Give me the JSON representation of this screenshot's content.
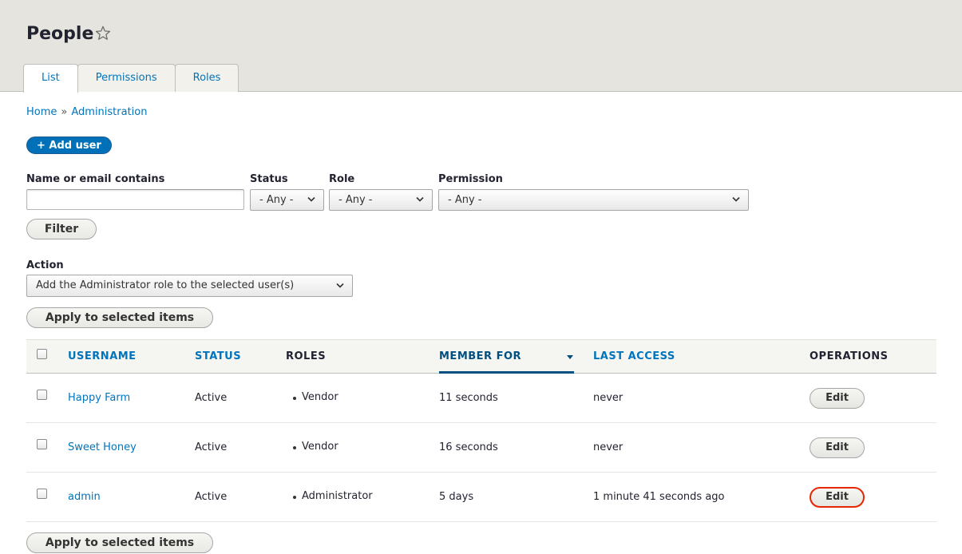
{
  "header": {
    "title": "People",
    "tabs": [
      {
        "label": "List",
        "active": true
      },
      {
        "label": "Permissions",
        "active": false
      },
      {
        "label": "Roles",
        "active": false
      }
    ]
  },
  "breadcrumb": {
    "items": [
      "Home",
      "Administration"
    ],
    "separator": "»"
  },
  "add_user_label": "+ Add user",
  "filters": {
    "name_label": "Name or email contains",
    "name_value": "",
    "status_label": "Status",
    "status_value": "- Any -",
    "role_label": "Role",
    "role_value": "- Any -",
    "permission_label": "Permission",
    "permission_value": "- Any -",
    "filter_button": "Filter"
  },
  "action": {
    "label": "Action",
    "value": "Add the Administrator role to the selected user(s)",
    "apply_button": "Apply to selected items"
  },
  "table": {
    "columns": {
      "username": "USERNAME",
      "status": "STATUS",
      "roles": "ROLES",
      "member_for": "MEMBER FOR",
      "last_access": "LAST ACCESS",
      "operations": "OPERATIONS"
    },
    "sorted_column": "member_for",
    "rows": [
      {
        "username": "Happy Farm",
        "status": "Active",
        "role": "Vendor",
        "member_for": "11 seconds",
        "last_access": "never",
        "operation": "Edit"
      },
      {
        "username": "Sweet Honey",
        "status": "Active",
        "role": "Vendor",
        "member_for": "16 seconds",
        "last_access": "never",
        "operation": "Edit"
      },
      {
        "username": "admin",
        "status": "Active",
        "role": "Administrator",
        "member_for": "5 days",
        "last_access": "1 minute 41 seconds ago",
        "operation": "Edit"
      }
    ]
  },
  "bottom_apply_button": "Apply to selected items",
  "colors": {
    "link": "#0074bd",
    "primary_button": "#0071b8",
    "focus_ring": "#e62600",
    "header_bg": "#e6e4df"
  },
  "icons": {
    "favorite": "star-outline-icon",
    "select": "chevron-down-icon",
    "sort": "sort-desc-icon"
  }
}
